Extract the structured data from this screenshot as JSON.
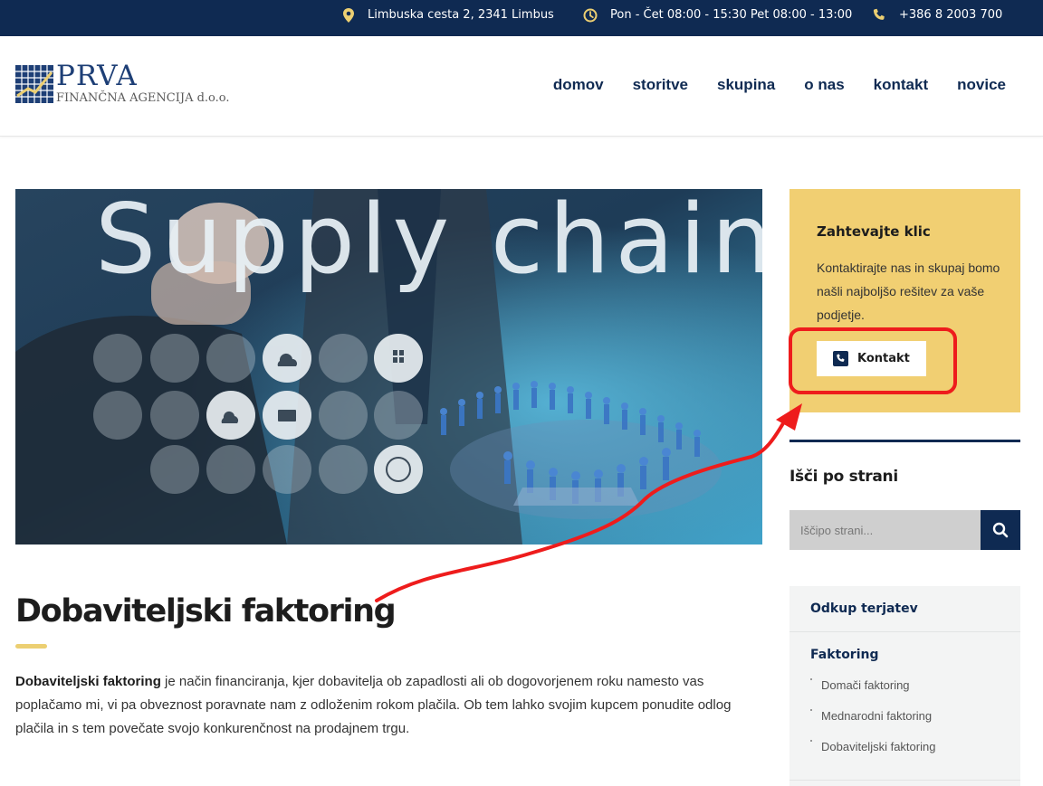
{
  "topbar": {
    "address": "Limbuska cesta 2, 2341 Limbus",
    "hours": "Pon - Čet 08:00 - 15:30 Pet 08:00 - 13:00",
    "phone": "+386 8 2003 700"
  },
  "logo": {
    "title": "PRVA",
    "subtitle": "FINANČNA AGENCIJA d.o.o."
  },
  "nav": {
    "items": [
      "domov",
      "storitve",
      "skupina",
      "o nas",
      "kontakt",
      "novice"
    ]
  },
  "hero": {
    "headline": "Supply chain"
  },
  "article": {
    "title": "Dobaviteljski faktoring",
    "lead_bold": "Dobaviteljski faktoring",
    "lead_text": " je način financiranja, kjer dobavitelja ob zapadlosti ali ob dogovorjenem roku namesto vas poplačamo mi, vi pa obveznost poravnate nam z odloženim rokom plačila. Ob tem lahko svojim kupcem ponudite odlog plačila in s tem povečate svojo konkurenčnost na prodajnem trgu."
  },
  "callbox": {
    "title": "Zahtevajte klic",
    "text": "Kontaktirajte nas in skupaj bomo našli najboljšo rešitev za vaše podjetje.",
    "button_label": "Kontakt"
  },
  "search": {
    "title": "Išči po strani",
    "placeholder": "Iščipo strani..."
  },
  "menu": {
    "item1": "Odkup terjatev",
    "item2": "Faktoring",
    "subitems": [
      "Domači faktoring",
      "Mednarodni faktoring",
      "Dobaviteljski faktoring"
    ]
  },
  "colors": {
    "navy": "#0f2a52",
    "gold": "#f1cf72",
    "annotation_red": "#ee1c1c"
  }
}
